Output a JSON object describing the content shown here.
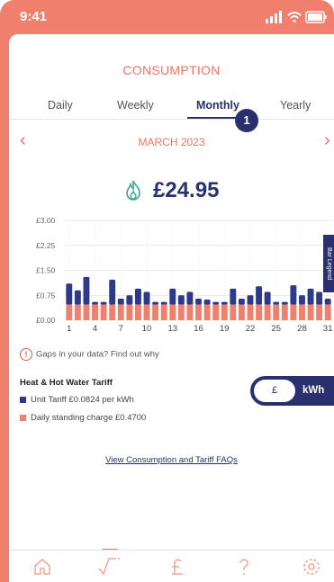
{
  "status_bar": {
    "time": "9:41"
  },
  "header": {
    "title": "CONSUMPTION"
  },
  "tabs": [
    {
      "label": "Daily",
      "active": false
    },
    {
      "label": "Weekly",
      "active": false
    },
    {
      "label": "Monthly",
      "active": true
    },
    {
      "label": "Yearly",
      "active": false
    }
  ],
  "badge": "1",
  "period": {
    "label": "MARCH 2023",
    "prev_icon": "chevron-left-icon",
    "next_icon": "chevron-right-icon"
  },
  "total": {
    "icon": "flame-icon",
    "amount": "£24.95"
  },
  "chart_data": {
    "type": "bar",
    "stacked": true,
    "yticks": [
      "£3.00",
      "£2.25",
      "£1.50",
      "£0.75",
      "£0.00"
    ],
    "ylim": [
      0,
      3.0
    ],
    "xticks": [
      "1",
      "4",
      "7",
      "10",
      "13",
      "16",
      "19",
      "22",
      "25",
      "28",
      "31"
    ],
    "categories": [
      "1",
      "2",
      "3",
      "4",
      "5",
      "6",
      "7",
      "8",
      "9",
      "10",
      "11",
      "12",
      "13",
      "14",
      "15",
      "16",
      "17",
      "18",
      "19",
      "20",
      "21",
      "22",
      "23",
      "24",
      "25",
      "26",
      "27",
      "28",
      "29",
      "30",
      "31"
    ],
    "series": [
      {
        "name": "Daily standing charge £0.4700",
        "color": "#f07f6d",
        "values": [
          0.47,
          0.47,
          0.47,
          0.47,
          0.47,
          0.47,
          0.47,
          0.47,
          0.47,
          0.47,
          0.47,
          0.47,
          0.47,
          0.47,
          0.47,
          0.47,
          0.47,
          0.47,
          0.47,
          0.47,
          0.47,
          0.47,
          0.47,
          0.47,
          0.47,
          0.47,
          0.47,
          0.47,
          0.47,
          0.47,
          0.47
        ]
      },
      {
        "name": "Unit Tariff £0.0824 per kWh",
        "color": "#2d3a8c",
        "values": [
          0.63,
          0.43,
          0.83,
          0.08,
          0.08,
          0.75,
          0.18,
          0.28,
          0.48,
          0.38,
          0.08,
          0.08,
          0.48,
          0.28,
          0.38,
          0.18,
          0.15,
          0.08,
          0.08,
          0.48,
          0.18,
          0.28,
          0.55,
          0.38,
          0.08,
          0.08,
          0.58,
          0.28,
          0.48,
          0.38,
          0.18
        ]
      }
    ],
    "grid": true,
    "side_tab_label": "Bar Legend"
  },
  "notice": {
    "icon": "warning-icon",
    "text": "Gaps in your data? Find out why"
  },
  "tariff": {
    "title": "Heat & Hot Water Tariff",
    "unit_label": "Unit Tariff £0.0824 per kWh",
    "standing_label": "Daily standing charge £0.4700",
    "unit_color": "#2d3a8c",
    "standing_color": "#f07f6d"
  },
  "toggle": {
    "left_label": "£",
    "right_label": "kWh"
  },
  "faq_link": "View Consumption and Tariff FAQs",
  "nav": [
    {
      "icon": "home-icon"
    },
    {
      "icon": "consumption-icon",
      "active": true
    },
    {
      "icon": "pound-icon"
    },
    {
      "icon": "help-icon"
    },
    {
      "icon": "settings-icon"
    }
  ]
}
